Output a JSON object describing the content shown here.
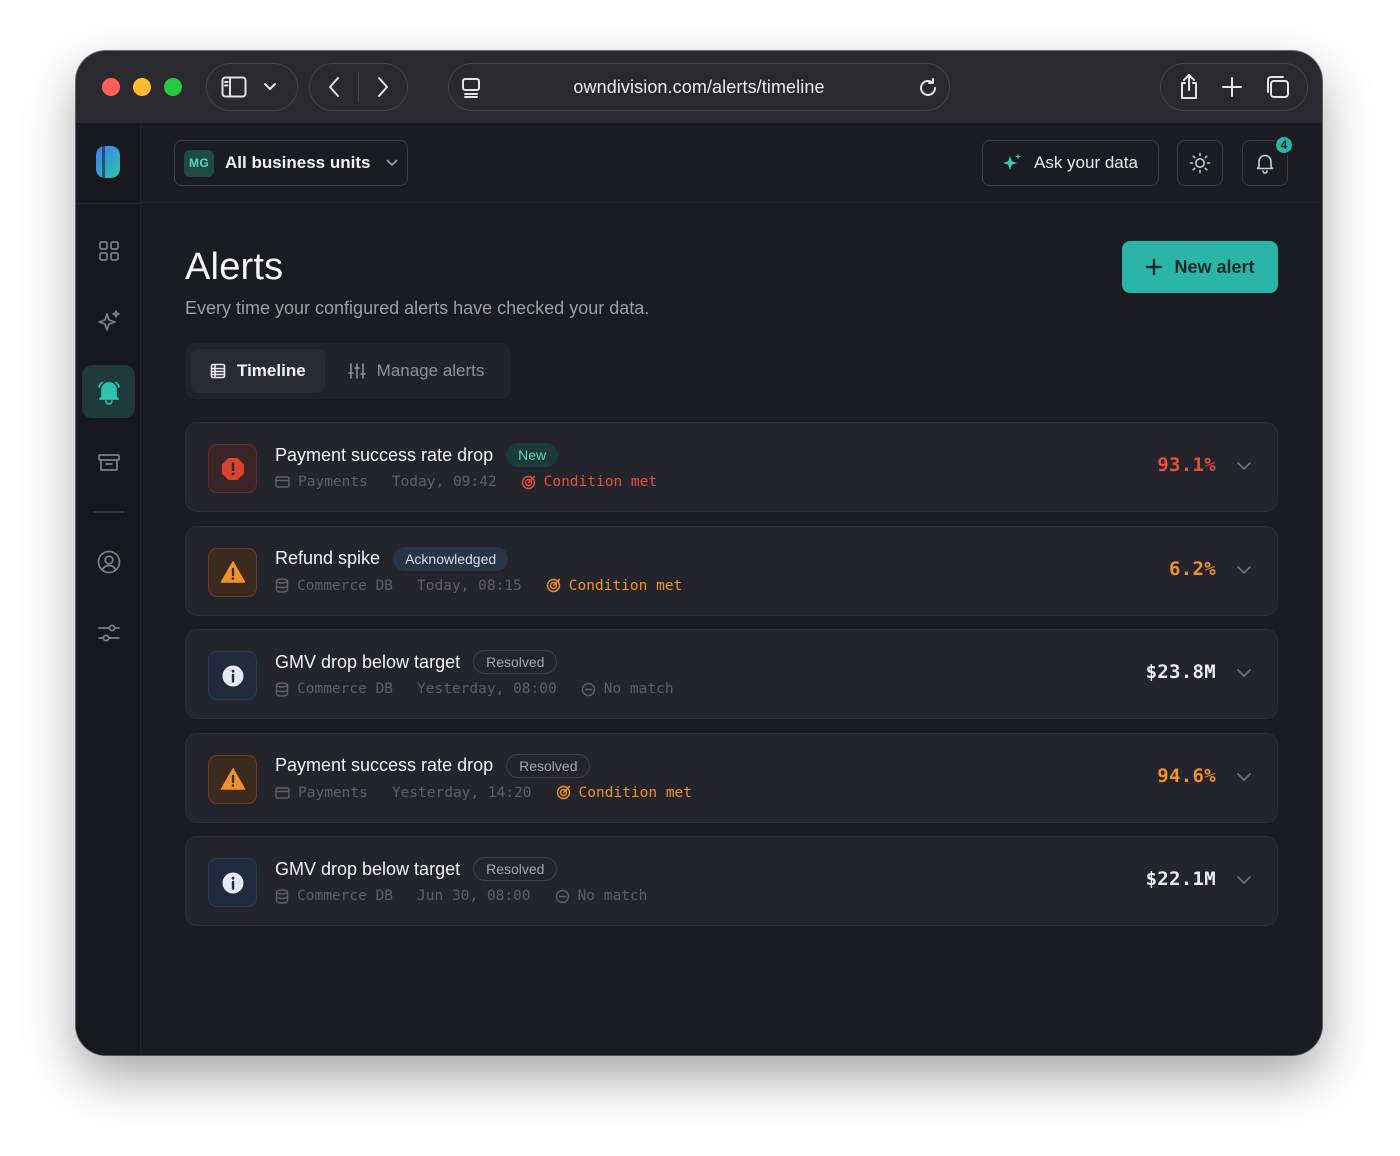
{
  "browser": {
    "url": "owndivision.com/alerts/timeline"
  },
  "topbar": {
    "business_unit": {
      "initials": "MG",
      "label": "All business units"
    },
    "ask_label": "Ask your data",
    "notification_count": "4"
  },
  "page": {
    "title": "Alerts",
    "subtitle": "Every time your configured alerts have checked your data.",
    "new_alert_label": "New alert"
  },
  "tabs": [
    {
      "label": "Timeline",
      "active": true
    },
    {
      "label": "Manage alerts",
      "active": false
    }
  ],
  "alerts": [
    {
      "title": "Payment success rate drop",
      "status": "New",
      "severity": "critical",
      "source": "Payments",
      "source_icon": "card-icon",
      "time": "Today, 09:42",
      "result": "Condition met",
      "value": "93.1%"
    },
    {
      "title": "Refund spike",
      "status": "Acknowledged",
      "severity": "warning",
      "source": "Commerce DB",
      "source_icon": "database-icon",
      "time": "Today, 08:15",
      "result": "Condition met",
      "value": "6.2%"
    },
    {
      "title": "GMV drop below target",
      "status": "Resolved",
      "severity": "info",
      "source": "Commerce DB",
      "source_icon": "database-icon",
      "time": "Yesterday, 08:00",
      "result": "No match",
      "value": "$23.8M"
    },
    {
      "title": "Payment success rate drop",
      "status": "Resolved",
      "severity": "warning",
      "source": "Payments",
      "source_icon": "card-icon",
      "time": "Yesterday, 14:20",
      "result": "Condition met",
      "value": "94.6%"
    },
    {
      "title": "GMV drop below target",
      "status": "Resolved",
      "severity": "info",
      "source": "Commerce DB",
      "source_icon": "database-icon",
      "time": "Jun 30, 08:00",
      "result": "No match",
      "value": "$22.1M"
    }
  ],
  "colors": {
    "accent": "#2ab5a6",
    "critical": "#e5503e",
    "warning": "#f0922a",
    "info": "#e9ebf2"
  }
}
